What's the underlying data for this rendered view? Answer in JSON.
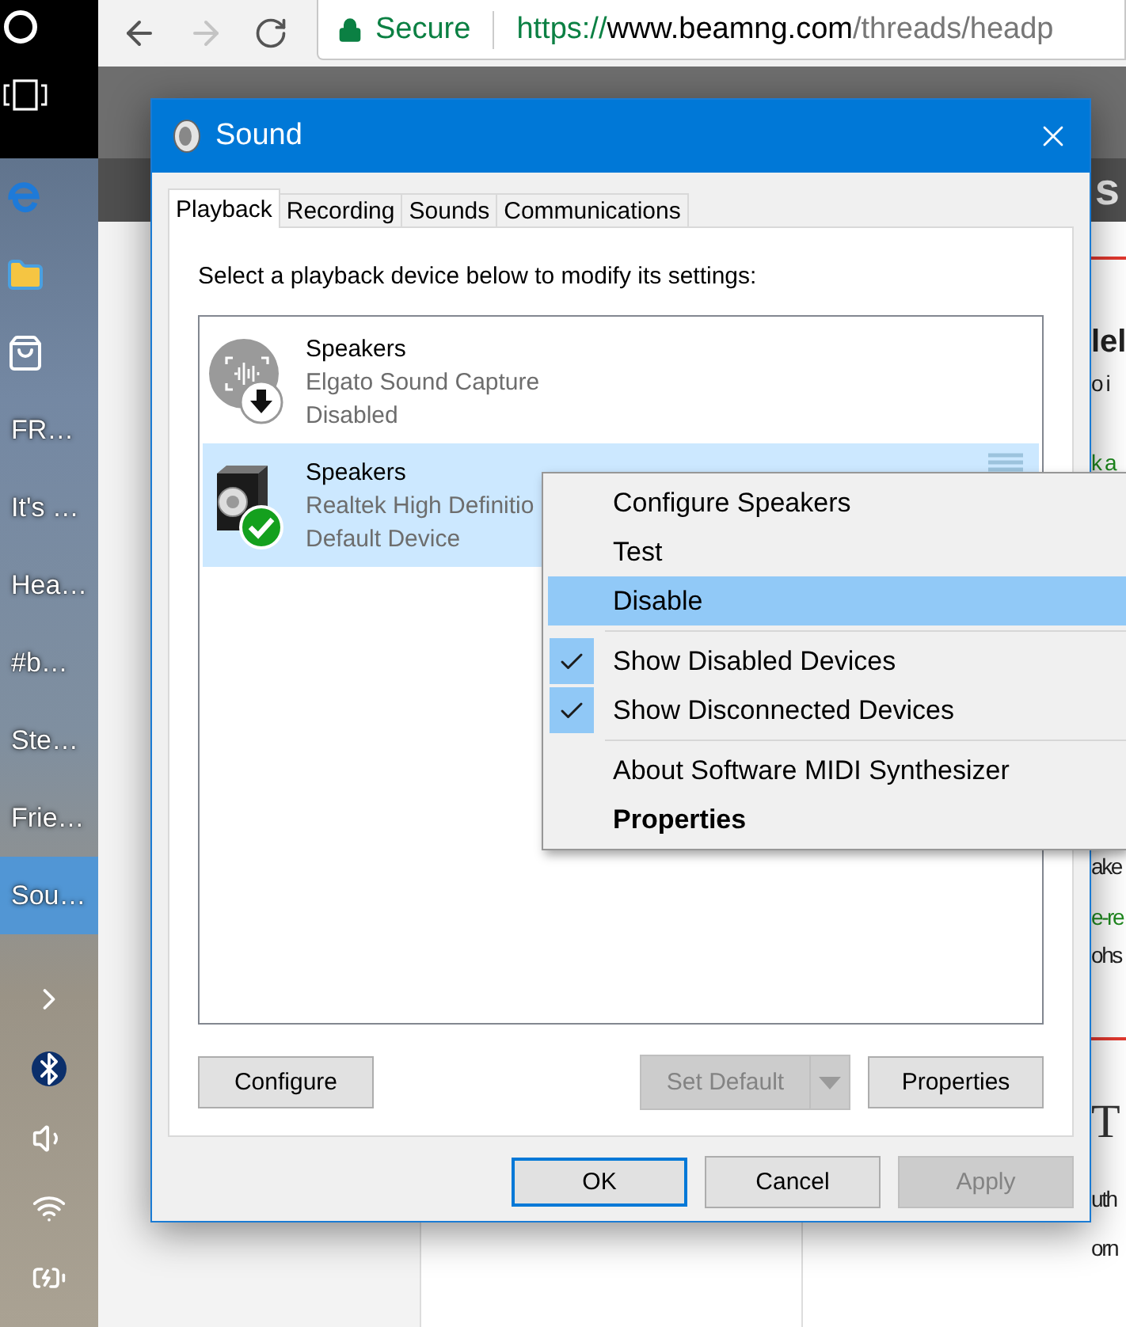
{
  "taskbar": {
    "windows": [
      {
        "label": "FR…",
        "selected": false
      },
      {
        "label": "It's …",
        "selected": false
      },
      {
        "label": "Hea…",
        "selected": false
      },
      {
        "label": "#b…",
        "selected": false
      },
      {
        "label": "Ste…",
        "selected": false
      },
      {
        "label": "Frie…",
        "selected": false
      },
      {
        "label": "Sou…",
        "selected": true
      }
    ]
  },
  "browser": {
    "address": {
      "secure_label": "Secure",
      "url_scheme": "https://",
      "url_host": "www.beamng.com",
      "url_path": "/threads/headp"
    },
    "header_text": "s",
    "page_fragments": [
      {
        "kind": "heading",
        "text": "lel"
      },
      {
        "kind": "text",
        "text": "o i"
      },
      {
        "kind": "link",
        "text": "k a"
      },
      {
        "kind": "text",
        "text": "ake"
      },
      {
        "kind": "link",
        "text": "e-re"
      },
      {
        "kind": "text",
        "text": "ohs"
      },
      {
        "kind": "title",
        "text": "T"
      },
      {
        "kind": "text",
        "text": "uth"
      },
      {
        "kind": "text",
        "text": "orn"
      }
    ]
  },
  "dialog": {
    "title": "Sound",
    "tabs": [
      {
        "label": "Playback",
        "selected": true
      },
      {
        "label": "Recording",
        "selected": false
      },
      {
        "label": "Sounds",
        "selected": false
      },
      {
        "label": "Communications",
        "selected": false
      }
    ],
    "instruction": "Select a playback device below to modify its settings:",
    "devices": [
      {
        "kind": "disabled",
        "name": "Speakers",
        "description": "Elgato Sound Capture",
        "status": "Disabled",
        "selected": false
      },
      {
        "kind": "default",
        "name": "Speakers",
        "description": "Realtek High Definitio",
        "status": "Default Device",
        "selected": true
      }
    ],
    "panel_buttons": {
      "configure": "Configure",
      "set_default": {
        "label": "Set Default",
        "disabled": true
      },
      "properties": "Properties"
    },
    "footer_buttons": [
      {
        "label": "OK",
        "disabled": false,
        "focused": true
      },
      {
        "label": "Cancel",
        "disabled": false,
        "focused": false
      },
      {
        "label": "Apply",
        "disabled": true,
        "focused": false
      }
    ]
  },
  "context_menu": {
    "groups": [
      [
        {
          "label": "Configure Speakers",
          "checked": false,
          "selected": false,
          "default": false
        },
        {
          "label": "Test",
          "checked": false,
          "selected": false,
          "default": false
        },
        {
          "label": "Disable",
          "checked": false,
          "selected": true,
          "default": false
        }
      ],
      [
        {
          "label": "Show Disabled Devices",
          "checked": true,
          "selected": false,
          "default": false
        },
        {
          "label": "Show Disconnected Devices",
          "checked": true,
          "selected": false,
          "default": false
        }
      ],
      [
        {
          "label": "About Software MIDI Synthesizer",
          "checked": false,
          "selected": false,
          "default": false
        },
        {
          "label": "Properties",
          "checked": false,
          "selected": false,
          "default": true
        }
      ]
    ]
  }
}
